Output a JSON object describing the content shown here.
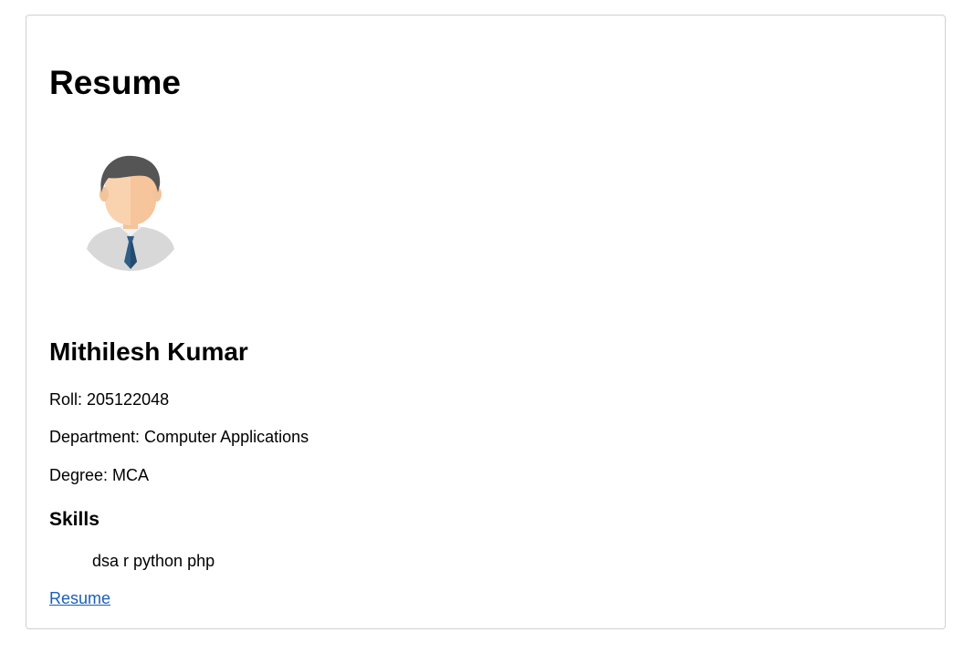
{
  "page": {
    "title": "Resume"
  },
  "profile": {
    "avatar_icon": "person-avatar-icon",
    "name": "Mithilesh Kumar",
    "roll": "Roll: 205122048",
    "department": "Department: Computer Applications",
    "degree": "Degree: MCA"
  },
  "skills": {
    "heading": "Skills",
    "list": "dsa r python php"
  },
  "links": {
    "resume_label": "Resume"
  },
  "colors": {
    "link": "#1a5fb4",
    "card_border": "#d0d0d0",
    "hair": "#555555",
    "skin": "#f9d3b0",
    "shirt": "#d8d8d8",
    "tie": "#2e5e86"
  }
}
